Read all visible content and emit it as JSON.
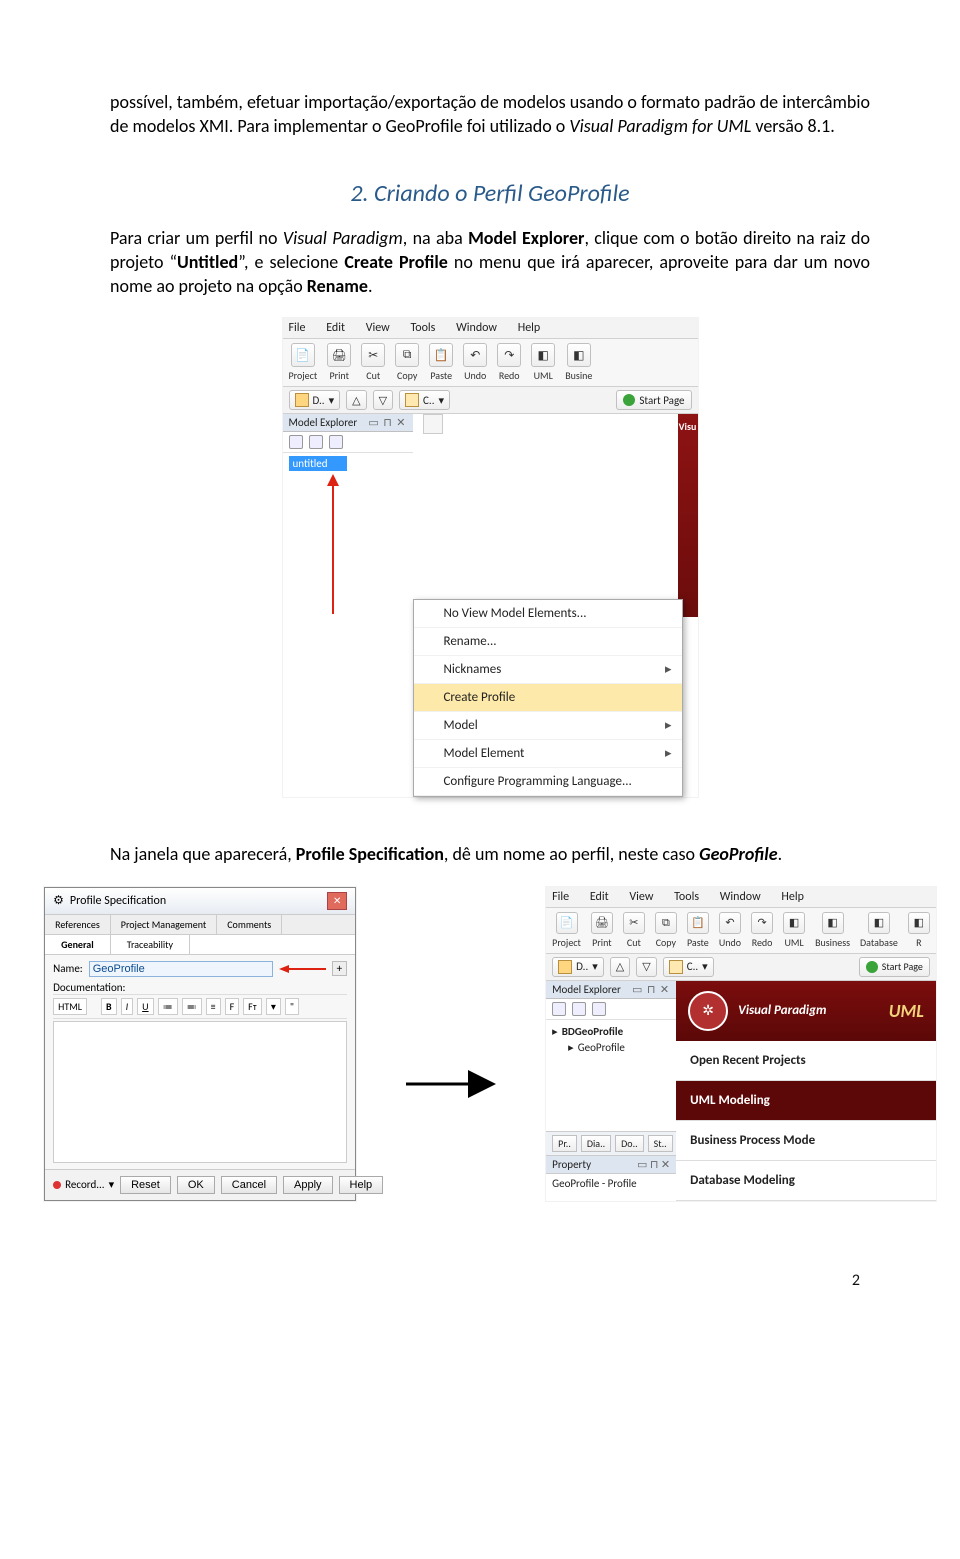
{
  "intro_html": "possível, também, efetuar importação/exportação de modelos usando o formato padrão de intercâmbio de modelos XMI. Para implementar o GeoProfile foi utilizado o <i>Visual Paradigm for UML</i> versão 8.1.",
  "heading": "2. Criando o Perfil GeoProfile",
  "para1_html": "Para criar um perfil no <i>Visual Paradigm</i>, na aba <b>Model Explorer</b>, clique com o botão direito na raiz do projeto “<b>Untitled</b>”, e selecione <b>Create Profile</b> no menu que irá aparecer, aproveite para dar um novo nome ao projeto na opção <b>Rename</b>.",
  "para2_html": "Na janela que aparecerá, <b>Profile Specification</b>, dê um nome ao perfil, neste caso <b><i>GeoProfile</i></b>.",
  "menu": {
    "file": "File",
    "edit": "Edit",
    "view": "View",
    "tools": "Tools",
    "window": "Window",
    "help": "Help"
  },
  "toolbar": {
    "project": "Project",
    "print": "Print",
    "cut": "Cut",
    "copy": "Copy",
    "paste": "Paste",
    "undo": "Undo",
    "redo": "Redo",
    "uml": "UML",
    "busine": "Busine",
    "business": "Business",
    "database": "Database",
    "r": "R"
  },
  "hbar": {
    "d": "D..",
    "c": "C..",
    "up": "△",
    "down": "▽"
  },
  "startpage": "Start Page",
  "explorer": "Model Explorer",
  "explorer_icons_title": "",
  "node_untitled": "untitled",
  "ctx": {
    "noview": "No View Model Elements...",
    "rename": "Rename...",
    "nick": "Nicknames",
    "create": "Create Profile",
    "model": "Model",
    "modelel": "Model Element",
    "cfg": "Configure Programming Language..."
  },
  "visu": "Visu",
  "dlg": {
    "title": "Profile Specification",
    "tabs_top": [
      "References",
      "Project Management",
      "Comments"
    ],
    "tabs_bot": [
      "General",
      "Traceability"
    ],
    "name_lbl": "Name:",
    "name_val": "GeoProfile",
    "doc_lbl": "Documentation:",
    "html": "HTML",
    "tools": [
      "B",
      "I",
      "U",
      "≔",
      "≕",
      "≡",
      "F",
      "Fᴛ",
      "▾",
      "\""
    ],
    "record": "Record...",
    "reset": "Reset",
    "ok": "OK",
    "cancel": "Cancel",
    "apply": "Apply",
    "help": "Help"
  },
  "vp2": {
    "node_proj": "BDGeoProfile",
    "node_prof": "GeoProfile",
    "banner": "Visual Paradigm",
    "uml": "UML",
    "items": [
      "Open Recent Projects",
      "UML Modeling",
      "Business Process Mode",
      "Database Modeling"
    ],
    "bottabs": [
      "Pr..",
      "Dia..",
      "Do..",
      "St.."
    ],
    "prop": "Property",
    "propval": "GeoProfile - Profile"
  },
  "page_number": "2"
}
